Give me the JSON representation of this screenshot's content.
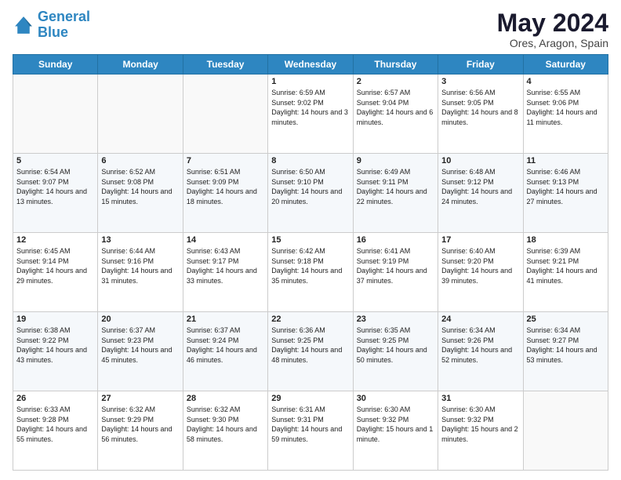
{
  "logo": {
    "line1": "General",
    "line2": "Blue"
  },
  "header": {
    "month_year": "May 2024",
    "location": "Ores, Aragon, Spain"
  },
  "weekdays": [
    "Sunday",
    "Monday",
    "Tuesday",
    "Wednesday",
    "Thursday",
    "Friday",
    "Saturday"
  ],
  "weeks": [
    [
      {
        "day": "",
        "sunrise": "",
        "sunset": "",
        "daylight": ""
      },
      {
        "day": "",
        "sunrise": "",
        "sunset": "",
        "daylight": ""
      },
      {
        "day": "",
        "sunrise": "",
        "sunset": "",
        "daylight": ""
      },
      {
        "day": "1",
        "sunrise": "Sunrise: 6:59 AM",
        "sunset": "Sunset: 9:02 PM",
        "daylight": "Daylight: 14 hours and 3 minutes."
      },
      {
        "day": "2",
        "sunrise": "Sunrise: 6:57 AM",
        "sunset": "Sunset: 9:04 PM",
        "daylight": "Daylight: 14 hours and 6 minutes."
      },
      {
        "day": "3",
        "sunrise": "Sunrise: 6:56 AM",
        "sunset": "Sunset: 9:05 PM",
        "daylight": "Daylight: 14 hours and 8 minutes."
      },
      {
        "day": "4",
        "sunrise": "Sunrise: 6:55 AM",
        "sunset": "Sunset: 9:06 PM",
        "daylight": "Daylight: 14 hours and 11 minutes."
      }
    ],
    [
      {
        "day": "5",
        "sunrise": "Sunrise: 6:54 AM",
        "sunset": "Sunset: 9:07 PM",
        "daylight": "Daylight: 14 hours and 13 minutes."
      },
      {
        "day": "6",
        "sunrise": "Sunrise: 6:52 AM",
        "sunset": "Sunset: 9:08 PM",
        "daylight": "Daylight: 14 hours and 15 minutes."
      },
      {
        "day": "7",
        "sunrise": "Sunrise: 6:51 AM",
        "sunset": "Sunset: 9:09 PM",
        "daylight": "Daylight: 14 hours and 18 minutes."
      },
      {
        "day": "8",
        "sunrise": "Sunrise: 6:50 AM",
        "sunset": "Sunset: 9:10 PM",
        "daylight": "Daylight: 14 hours and 20 minutes."
      },
      {
        "day": "9",
        "sunrise": "Sunrise: 6:49 AM",
        "sunset": "Sunset: 9:11 PM",
        "daylight": "Daylight: 14 hours and 22 minutes."
      },
      {
        "day": "10",
        "sunrise": "Sunrise: 6:48 AM",
        "sunset": "Sunset: 9:12 PM",
        "daylight": "Daylight: 14 hours and 24 minutes."
      },
      {
        "day": "11",
        "sunrise": "Sunrise: 6:46 AM",
        "sunset": "Sunset: 9:13 PM",
        "daylight": "Daylight: 14 hours and 27 minutes."
      }
    ],
    [
      {
        "day": "12",
        "sunrise": "Sunrise: 6:45 AM",
        "sunset": "Sunset: 9:14 PM",
        "daylight": "Daylight: 14 hours and 29 minutes."
      },
      {
        "day": "13",
        "sunrise": "Sunrise: 6:44 AM",
        "sunset": "Sunset: 9:16 PM",
        "daylight": "Daylight: 14 hours and 31 minutes."
      },
      {
        "day": "14",
        "sunrise": "Sunrise: 6:43 AM",
        "sunset": "Sunset: 9:17 PM",
        "daylight": "Daylight: 14 hours and 33 minutes."
      },
      {
        "day": "15",
        "sunrise": "Sunrise: 6:42 AM",
        "sunset": "Sunset: 9:18 PM",
        "daylight": "Daylight: 14 hours and 35 minutes."
      },
      {
        "day": "16",
        "sunrise": "Sunrise: 6:41 AM",
        "sunset": "Sunset: 9:19 PM",
        "daylight": "Daylight: 14 hours and 37 minutes."
      },
      {
        "day": "17",
        "sunrise": "Sunrise: 6:40 AM",
        "sunset": "Sunset: 9:20 PM",
        "daylight": "Daylight: 14 hours and 39 minutes."
      },
      {
        "day": "18",
        "sunrise": "Sunrise: 6:39 AM",
        "sunset": "Sunset: 9:21 PM",
        "daylight": "Daylight: 14 hours and 41 minutes."
      }
    ],
    [
      {
        "day": "19",
        "sunrise": "Sunrise: 6:38 AM",
        "sunset": "Sunset: 9:22 PM",
        "daylight": "Daylight: 14 hours and 43 minutes."
      },
      {
        "day": "20",
        "sunrise": "Sunrise: 6:37 AM",
        "sunset": "Sunset: 9:23 PM",
        "daylight": "Daylight: 14 hours and 45 minutes."
      },
      {
        "day": "21",
        "sunrise": "Sunrise: 6:37 AM",
        "sunset": "Sunset: 9:24 PM",
        "daylight": "Daylight: 14 hours and 46 minutes."
      },
      {
        "day": "22",
        "sunrise": "Sunrise: 6:36 AM",
        "sunset": "Sunset: 9:25 PM",
        "daylight": "Daylight: 14 hours and 48 minutes."
      },
      {
        "day": "23",
        "sunrise": "Sunrise: 6:35 AM",
        "sunset": "Sunset: 9:25 PM",
        "daylight": "Daylight: 14 hours and 50 minutes."
      },
      {
        "day": "24",
        "sunrise": "Sunrise: 6:34 AM",
        "sunset": "Sunset: 9:26 PM",
        "daylight": "Daylight: 14 hours and 52 minutes."
      },
      {
        "day": "25",
        "sunrise": "Sunrise: 6:34 AM",
        "sunset": "Sunset: 9:27 PM",
        "daylight": "Daylight: 14 hours and 53 minutes."
      }
    ],
    [
      {
        "day": "26",
        "sunrise": "Sunrise: 6:33 AM",
        "sunset": "Sunset: 9:28 PM",
        "daylight": "Daylight: 14 hours and 55 minutes."
      },
      {
        "day": "27",
        "sunrise": "Sunrise: 6:32 AM",
        "sunset": "Sunset: 9:29 PM",
        "daylight": "Daylight: 14 hours and 56 minutes."
      },
      {
        "day": "28",
        "sunrise": "Sunrise: 6:32 AM",
        "sunset": "Sunset: 9:30 PM",
        "daylight": "Daylight: 14 hours and 58 minutes."
      },
      {
        "day": "29",
        "sunrise": "Sunrise: 6:31 AM",
        "sunset": "Sunset: 9:31 PM",
        "daylight": "Daylight: 14 hours and 59 minutes."
      },
      {
        "day": "30",
        "sunrise": "Sunrise: 6:30 AM",
        "sunset": "Sunset: 9:32 PM",
        "daylight": "Daylight: 15 hours and 1 minute."
      },
      {
        "day": "31",
        "sunrise": "Sunrise: 6:30 AM",
        "sunset": "Sunset: 9:32 PM",
        "daylight": "Daylight: 15 hours and 2 minutes."
      },
      {
        "day": "",
        "sunrise": "",
        "sunset": "",
        "daylight": ""
      }
    ]
  ]
}
